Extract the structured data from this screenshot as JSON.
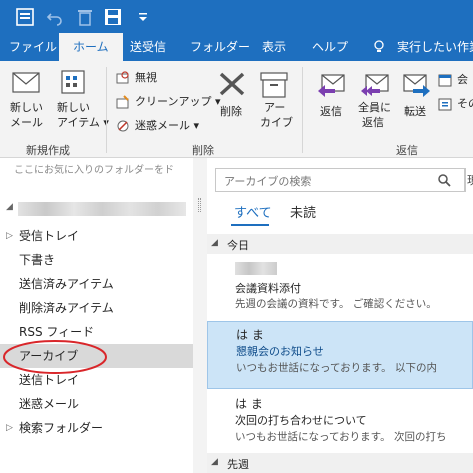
{
  "titlebar": {
    "icons": [
      "app-icon",
      "undo-icon",
      "delete-icon",
      "save-icon",
      "dropdown-icon"
    ]
  },
  "menu": {
    "tabs": [
      "ファイル",
      "ホーム",
      "送受信",
      "フォルダー",
      "表示",
      "ヘルプ"
    ],
    "tell_me": "実行したい作業"
  },
  "ribbon": {
    "new_mail": [
      "新しい",
      "メール"
    ],
    "new_item": [
      "新しい",
      "アイテム"
    ],
    "group_new": "新規作成",
    "ignore": "無視",
    "cleanup": "クリーンアップ",
    "junk": "迷惑メール",
    "delete": "削除",
    "archive": [
      "アー",
      "カイブ"
    ],
    "group_delete": "削除",
    "reply": "返信",
    "reply_all": [
      "全員に",
      "返信"
    ],
    "forward": "転送",
    "meeting": "会",
    "other": "その",
    "group_respond": "返信"
  },
  "left": {
    "fav_hint": "ここにお気に入りのフォルダーをド",
    "folders": [
      {
        "label": "受信トレイ",
        "arrow": "▷"
      },
      {
        "label": "下書き",
        "arrow": ""
      },
      {
        "label": "送信済みアイテム",
        "arrow": ""
      },
      {
        "label": "削除済みアイテム",
        "arrow": ""
      },
      {
        "label": "RSS フィード",
        "arrow": ""
      },
      {
        "label": "アーカイブ",
        "arrow": ""
      },
      {
        "label": "送信トレイ",
        "arrow": ""
      },
      {
        "label": "迷惑メール",
        "arrow": ""
      },
      {
        "label": "検索フォルダー",
        "arrow": "▷"
      }
    ]
  },
  "right": {
    "search_placeholder": "アーカイブの検索",
    "search_scope": "現",
    "filter_all": "すべて",
    "filter_unread": "未読",
    "group_today": "今日",
    "group_lastweek": "先週",
    "messages": [
      {
        "from": "",
        "subject": "会議資料添付",
        "preview": "先週の会議の資料です。 ご確認ください。"
      },
      {
        "from": "は ま",
        "subject": "懇親会のお知らせ",
        "preview": "いつもお世話になっております。 以下の内"
      },
      {
        "from": "は ま",
        "subject": "次回の打ち合わせについて",
        "preview": "いつもお世話になっております。 次回の打ち"
      }
    ]
  },
  "colors": {
    "brand": "#1e6fbf",
    "selected_message": "#cce4f7",
    "annotation_circle": "#d9262a"
  }
}
